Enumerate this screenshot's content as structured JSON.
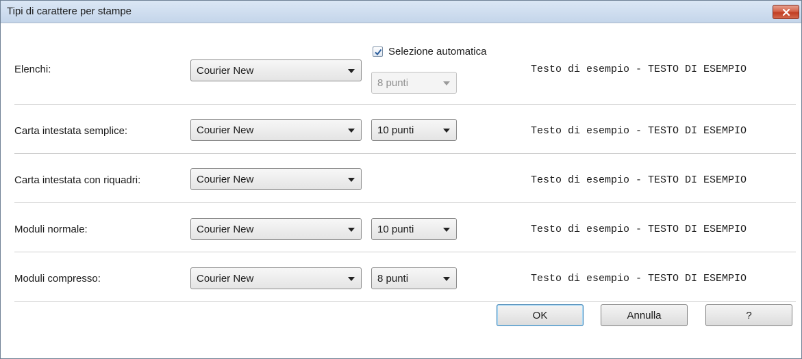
{
  "window": {
    "title": "Tipi di carattere per stampe"
  },
  "auto_select": {
    "label": "Selezione automatica",
    "checked": true
  },
  "sample_text": "Testo di esempio - TESTO DI ESEMPIO",
  "rows": [
    {
      "label": "Elenchi:",
      "font": "Courier New",
      "size": "8 punti",
      "size_enabled": false
    },
    {
      "label": "Carta intestata semplice:",
      "font": "Courier New",
      "size": "10 punti",
      "size_enabled": true
    },
    {
      "label": "Carta intestata con riquadri:",
      "font": "Courier New"
    },
    {
      "label": "Moduli normale:",
      "font": "Courier New",
      "size": "10 punti",
      "size_enabled": true
    },
    {
      "label": "Moduli compresso:",
      "font": "Courier New",
      "size": "8 punti",
      "size_enabled": true
    }
  ],
  "buttons": {
    "ok": "OK",
    "cancel": "Annulla",
    "help": "?"
  },
  "colors": {
    "close_button": "#c13d22",
    "titlebar": "#c4d5ea",
    "default_button_border": "#3c7fb1"
  }
}
